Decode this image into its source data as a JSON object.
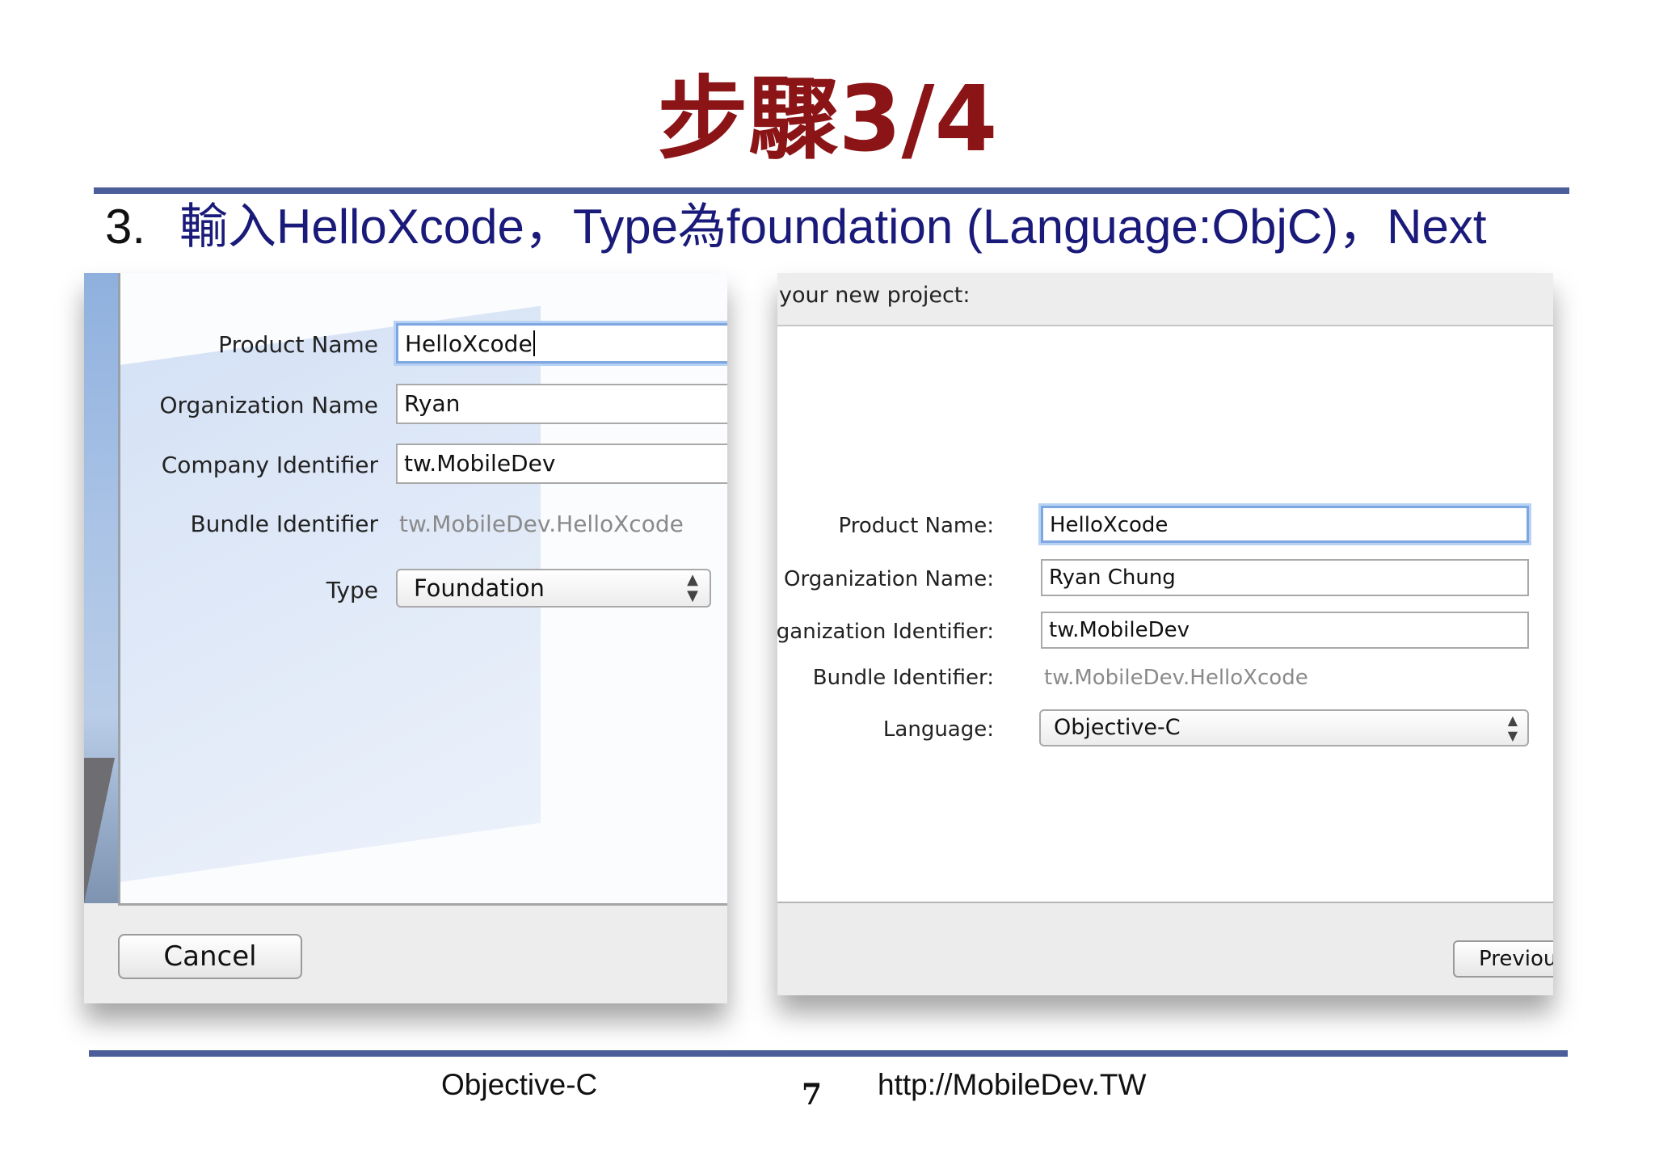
{
  "slide": {
    "title": "步驟3/4",
    "step_number": "3.",
    "step_text": "輸入HelloXcode，Type為foundation (Language:ObjC)，Next"
  },
  "left_dialog": {
    "fields": [
      {
        "label": "Product Name",
        "value": "HelloXcode"
      },
      {
        "label": "Organization Name",
        "value": "Ryan"
      },
      {
        "label": "Company Identifier",
        "value": "tw.MobileDev"
      }
    ],
    "bundle": {
      "label": "Bundle Identifier",
      "value": "tw.MobileDev.HelloXcode"
    },
    "type": {
      "label": "Type",
      "value": "Foundation"
    },
    "cancel_label": "Cancel"
  },
  "right_dialog": {
    "header": "your new project:",
    "fields": [
      {
        "label": "Product Name:",
        "value": "HelloXcode"
      },
      {
        "label": "Organization Name:",
        "value": "Ryan Chung"
      },
      {
        "label": "Organization Identifier:",
        "value": "tw.MobileDev"
      }
    ],
    "bundle": {
      "label": "Bundle Identifier:",
      "value": "tw.MobileDev.HelloXcode"
    },
    "language": {
      "label": "Language:",
      "value": "Objective-C"
    },
    "previous_label": "Previou"
  },
  "footer": {
    "left": "Objective-C",
    "page": "7",
    "right": "http://MobileDev.TW"
  },
  "colors": {
    "title": "#8b1417",
    "step_text": "#1a1a7a",
    "rule": "#4b5e9a",
    "focus_ring": "#7ea6e0"
  },
  "icons": [
    "updown-arrows-icon"
  ]
}
